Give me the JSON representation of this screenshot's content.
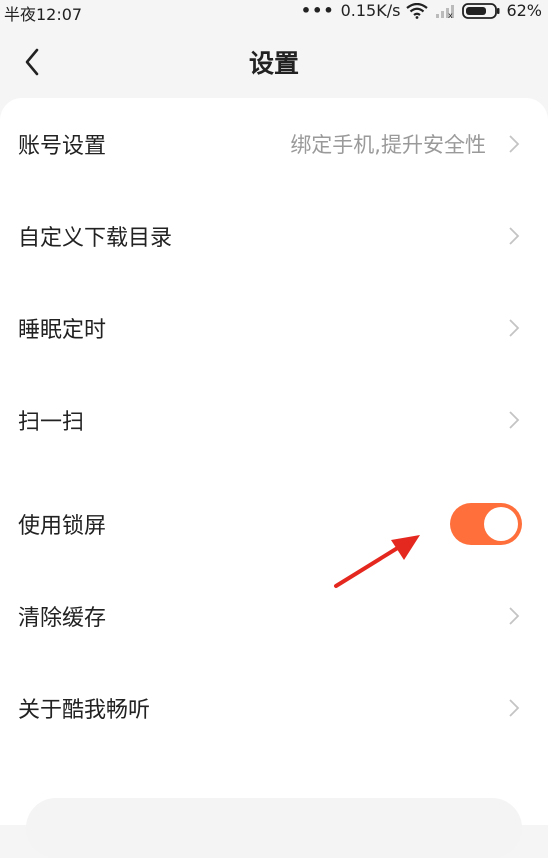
{
  "status_bar": {
    "time": "半夜12:07",
    "net_speed": "0.15K/s",
    "battery": "62%"
  },
  "header": {
    "title": "设置"
  },
  "settings": [
    {
      "label": "账号设置",
      "hint": "绑定手机,提升安全性",
      "type": "link"
    },
    {
      "label": "自定义下载目录",
      "type": "link"
    },
    {
      "label": "睡眠定时",
      "type": "link"
    },
    {
      "label": "扫一扫",
      "type": "link"
    },
    {
      "label": "使用锁屏",
      "type": "toggle",
      "on": true
    },
    {
      "label": "清除缓存",
      "type": "link"
    },
    {
      "label": "关于酷我畅听",
      "type": "link"
    }
  ],
  "colors": {
    "accent": "#ff6f3c",
    "annotation_arrow": "#e5281f"
  },
  "icons": {
    "back": "chevron-left-icon",
    "row_chevron": "chevron-right-icon",
    "wifi": "wifi-icon",
    "signal": "signal-icon",
    "battery": "battery-icon"
  }
}
